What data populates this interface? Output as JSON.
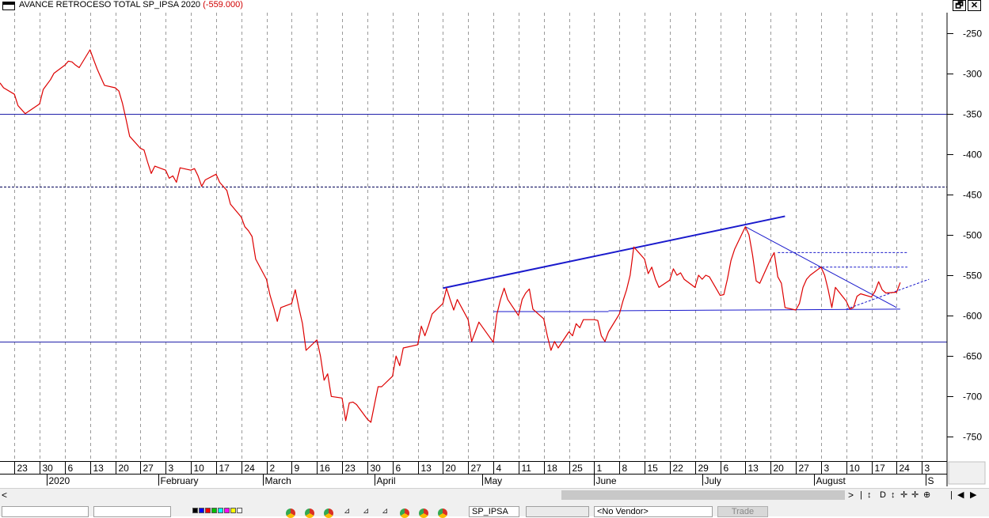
{
  "window": {
    "title": "AVANCE RETROCESO TOTAL SP_IPSA 2020",
    "last_value": "(-559.000)",
    "restore_label": "🗗",
    "close_label": "✕"
  },
  "colors": {
    "series": "#dd0000",
    "trendline": "#1a1acc",
    "level": "#2020aa",
    "grid": "#9a9a9a"
  },
  "chart_data": {
    "type": "line",
    "title": "AVANCE RETROCESO TOTAL SP_IPSA 2020",
    "ylim": [
      -780,
      -225
    ],
    "yticks": [
      -250,
      -300,
      -350,
      -400,
      -450,
      -500,
      -550,
      -600,
      -650,
      -700,
      -750
    ],
    "x_start": "2019-12-19",
    "x_end": "2020-09-07",
    "x_tick_labels": [
      {
        "date": "2019-12-23",
        "label": "23"
      },
      {
        "date": "2019-12-30",
        "label": "30"
      },
      {
        "date": "2020-01-06",
        "label": "6"
      },
      {
        "date": "2020-01-13",
        "label": "13"
      },
      {
        "date": "2020-01-20",
        "label": "20"
      },
      {
        "date": "2020-01-27",
        "label": "27"
      },
      {
        "date": "2020-02-03",
        "label": "3"
      },
      {
        "date": "2020-02-10",
        "label": "10"
      },
      {
        "date": "2020-02-17",
        "label": "17"
      },
      {
        "date": "2020-02-24",
        "label": "24"
      },
      {
        "date": "2020-03-02",
        "label": "2"
      },
      {
        "date": "2020-03-09",
        "label": "9"
      },
      {
        "date": "2020-03-16",
        "label": "16"
      },
      {
        "date": "2020-03-23",
        "label": "23"
      },
      {
        "date": "2020-03-30",
        "label": "30"
      },
      {
        "date": "2020-04-06",
        "label": "6"
      },
      {
        "date": "2020-04-13",
        "label": "13"
      },
      {
        "date": "2020-04-20",
        "label": "20"
      },
      {
        "date": "2020-04-27",
        "label": "27"
      },
      {
        "date": "2020-05-04",
        "label": "4"
      },
      {
        "date": "2020-05-11",
        "label": "11"
      },
      {
        "date": "2020-05-18",
        "label": "18"
      },
      {
        "date": "2020-05-25",
        "label": "25"
      },
      {
        "date": "2020-06-01",
        "label": "1"
      },
      {
        "date": "2020-06-08",
        "label": "8"
      },
      {
        "date": "2020-06-15",
        "label": "15"
      },
      {
        "date": "2020-06-22",
        "label": "22"
      },
      {
        "date": "2020-06-29",
        "label": "29"
      },
      {
        "date": "2020-07-06",
        "label": "6"
      },
      {
        "date": "2020-07-13",
        "label": "13"
      },
      {
        "date": "2020-07-20",
        "label": "20"
      },
      {
        "date": "2020-07-27",
        "label": "27"
      },
      {
        "date": "2020-08-03",
        "label": "3"
      },
      {
        "date": "2020-08-10",
        "label": "10"
      },
      {
        "date": "2020-08-17",
        "label": "17"
      },
      {
        "date": "2020-08-24",
        "label": "24"
      },
      {
        "date": "2020-08-31",
        "label": "3"
      }
    ],
    "month_labels": [
      {
        "date": "2020-01-01",
        "label": "2020"
      },
      {
        "date": "2020-02-01",
        "label": "February"
      },
      {
        "date": "2020-03-01",
        "label": "March"
      },
      {
        "date": "2020-04-01",
        "label": "April"
      },
      {
        "date": "2020-05-01",
        "label": "May"
      },
      {
        "date": "2020-06-01",
        "label": "June"
      },
      {
        "date": "2020-07-01",
        "label": "July"
      },
      {
        "date": "2020-08-01",
        "label": "August"
      },
      {
        "date": "2020-09-01",
        "label": "S"
      }
    ],
    "series": [
      {
        "points": [
          [
            "2019-12-19",
            -312
          ],
          [
            "2019-12-20",
            -318
          ],
          [
            "2019-12-23",
            -326
          ],
          [
            "2019-12-24",
            -340
          ],
          [
            "2019-12-26",
            -350
          ],
          [
            "2019-12-27",
            -347
          ],
          [
            "2019-12-30",
            -338
          ],
          [
            "2019-12-31",
            -320
          ],
          [
            "2020-01-02",
            -308
          ],
          [
            "2020-01-03",
            -300
          ],
          [
            "2020-01-06",
            -290
          ],
          [
            "2020-01-07",
            -285
          ],
          [
            "2020-01-08",
            -286
          ],
          [
            "2020-01-09",
            -290
          ],
          [
            "2020-01-10",
            -293
          ],
          [
            "2020-01-13",
            -271
          ],
          [
            "2020-01-14",
            -283
          ],
          [
            "2020-01-15",
            -295
          ],
          [
            "2020-01-16",
            -305
          ],
          [
            "2020-01-17",
            -315
          ],
          [
            "2020-01-20",
            -318
          ],
          [
            "2020-01-21",
            -322
          ],
          [
            "2020-01-22",
            -337
          ],
          [
            "2020-01-23",
            -357
          ],
          [
            "2020-01-24",
            -378
          ],
          [
            "2020-01-27",
            -393
          ],
          [
            "2020-01-28",
            -395
          ],
          [
            "2020-01-29",
            -410
          ],
          [
            "2020-01-30",
            -424
          ],
          [
            "2020-01-31",
            -415
          ],
          [
            "2020-02-03",
            -420
          ],
          [
            "2020-02-04",
            -430
          ],
          [
            "2020-02-05",
            -427
          ],
          [
            "2020-02-06",
            -435
          ],
          [
            "2020-02-07",
            -417
          ],
          [
            "2020-02-10",
            -420
          ],
          [
            "2020-02-11",
            -418
          ],
          [
            "2020-02-12",
            -427
          ],
          [
            "2020-02-13",
            -440
          ],
          [
            "2020-02-14",
            -432
          ],
          [
            "2020-02-17",
            -425
          ],
          [
            "2020-02-18",
            -435
          ],
          [
            "2020-02-19",
            -440
          ],
          [
            "2020-02-20",
            -445
          ],
          [
            "2020-02-21",
            -462
          ],
          [
            "2020-02-24",
            -478
          ],
          [
            "2020-02-25",
            -490
          ],
          [
            "2020-02-26",
            -495
          ],
          [
            "2020-02-27",
            -502
          ],
          [
            "2020-02-28",
            -530
          ],
          [
            "2020-03-02",
            -555
          ],
          [
            "2020-03-03",
            -575
          ],
          [
            "2020-03-04",
            -590
          ],
          [
            "2020-03-05",
            -607
          ],
          [
            "2020-03-06",
            -590
          ],
          [
            "2020-03-09",
            -585
          ],
          [
            "2020-03-10",
            -568
          ],
          [
            "2020-03-11",
            -590
          ],
          [
            "2020-03-12",
            -610
          ],
          [
            "2020-03-13",
            -643
          ],
          [
            "2020-03-16",
            -630
          ],
          [
            "2020-03-17",
            -650
          ],
          [
            "2020-03-18",
            -680
          ],
          [
            "2020-03-19",
            -672
          ],
          [
            "2020-03-20",
            -700
          ],
          [
            "2020-03-23",
            -702
          ],
          [
            "2020-03-24",
            -730
          ],
          [
            "2020-03-25",
            -708
          ],
          [
            "2020-03-26",
            -707
          ],
          [
            "2020-03-27",
            -710
          ],
          [
            "2020-03-30",
            -728
          ],
          [
            "2020-03-31",
            -732
          ],
          [
            "2020-04-01",
            -710
          ],
          [
            "2020-04-02",
            -688
          ],
          [
            "2020-04-03",
            -688
          ],
          [
            "2020-04-06",
            -675
          ],
          [
            "2020-04-07",
            -650
          ],
          [
            "2020-04-08",
            -662
          ],
          [
            "2020-04-09",
            -640
          ],
          [
            "2020-04-13",
            -636
          ],
          [
            "2020-04-14",
            -613
          ],
          [
            "2020-04-15",
            -625
          ],
          [
            "2020-04-16",
            -612
          ],
          [
            "2020-04-17",
            -598
          ],
          [
            "2020-04-20",
            -585
          ],
          [
            "2020-04-21",
            -566
          ],
          [
            "2020-04-22",
            -580
          ],
          [
            "2020-04-23",
            -593
          ],
          [
            "2020-04-24",
            -580
          ],
          [
            "2020-04-27",
            -605
          ],
          [
            "2020-04-28",
            -632
          ],
          [
            "2020-04-29",
            -620
          ],
          [
            "2020-04-30",
            -608
          ],
          [
            "2020-05-04",
            -633
          ],
          [
            "2020-05-05",
            -598
          ],
          [
            "2020-05-06",
            -580
          ],
          [
            "2020-05-07",
            -566
          ],
          [
            "2020-05-08",
            -580
          ],
          [
            "2020-05-11",
            -600
          ],
          [
            "2020-05-12",
            -580
          ],
          [
            "2020-05-13",
            -572
          ],
          [
            "2020-05-14",
            -567
          ],
          [
            "2020-05-15",
            -592
          ],
          [
            "2020-05-18",
            -604
          ],
          [
            "2020-05-19",
            -625
          ],
          [
            "2020-05-20",
            -643
          ],
          [
            "2020-05-21",
            -632
          ],
          [
            "2020-05-22",
            -640
          ],
          [
            "2020-05-25",
            -620
          ],
          [
            "2020-05-26",
            -625
          ],
          [
            "2020-05-27",
            -610
          ],
          [
            "2020-05-28",
            -615
          ],
          [
            "2020-05-29",
            -605
          ],
          [
            "2020-06-01",
            -605
          ],
          [
            "2020-06-02",
            -606
          ],
          [
            "2020-06-03",
            -625
          ],
          [
            "2020-06-04",
            -632
          ],
          [
            "2020-06-05",
            -620
          ],
          [
            "2020-06-08",
            -598
          ],
          [
            "2020-06-09",
            -582
          ],
          [
            "2020-06-10",
            -568
          ],
          [
            "2020-06-11",
            -550
          ],
          [
            "2020-06-12",
            -515
          ],
          [
            "2020-06-15",
            -530
          ],
          [
            "2020-06-16",
            -548
          ],
          [
            "2020-06-17",
            -540
          ],
          [
            "2020-06-18",
            -555
          ],
          [
            "2020-06-19",
            -565
          ],
          [
            "2020-06-22",
            -556
          ],
          [
            "2020-06-23",
            -542
          ],
          [
            "2020-06-24",
            -550
          ],
          [
            "2020-06-25",
            -547
          ],
          [
            "2020-06-26",
            -555
          ],
          [
            "2020-06-29",
            -565
          ],
          [
            "2020-06-30",
            -550
          ],
          [
            "2020-07-01",
            -555
          ],
          [
            "2020-07-02",
            -550
          ],
          [
            "2020-07-03",
            -552
          ],
          [
            "2020-07-06",
            -575
          ],
          [
            "2020-07-07",
            -574
          ],
          [
            "2020-07-08",
            -555
          ],
          [
            "2020-07-09",
            -532
          ],
          [
            "2020-07-10",
            -518
          ],
          [
            "2020-07-13",
            -490
          ],
          [
            "2020-07-14",
            -500
          ],
          [
            "2020-07-15",
            -525
          ],
          [
            "2020-07-16",
            -557
          ],
          [
            "2020-07-17",
            -560
          ],
          [
            "2020-07-20",
            -530
          ],
          [
            "2020-07-21",
            -522
          ],
          [
            "2020-07-22",
            -552
          ],
          [
            "2020-07-23",
            -560
          ],
          [
            "2020-07-24",
            -590
          ],
          [
            "2020-07-27",
            -593
          ],
          [
            "2020-07-28",
            -585
          ],
          [
            "2020-07-29",
            -565
          ],
          [
            "2020-07-30",
            -555
          ],
          [
            "2020-07-31",
            -550
          ],
          [
            "2020-08-03",
            -540
          ],
          [
            "2020-08-04",
            -550
          ],
          [
            "2020-08-05",
            -568
          ],
          [
            "2020-08-06",
            -590
          ],
          [
            "2020-08-07",
            -565
          ],
          [
            "2020-08-10",
            -582
          ],
          [
            "2020-08-11",
            -592
          ],
          [
            "2020-08-12",
            -590
          ],
          [
            "2020-08-13",
            -576
          ],
          [
            "2020-08-14",
            -573
          ],
          [
            "2020-08-17",
            -577
          ],
          [
            "2020-08-18",
            -570
          ],
          [
            "2020-08-19",
            -558
          ],
          [
            "2020-08-20",
            -568
          ],
          [
            "2020-08-21",
            -572
          ],
          [
            "2020-08-24",
            -571
          ],
          [
            "2020-08-25",
            -559
          ]
        ]
      }
    ],
    "h_lines": [
      {
        "y": -350,
        "style": "solid"
      },
      {
        "y": -440,
        "style": "dashed"
      },
      {
        "y": -632,
        "style": "solid"
      }
    ],
    "trendlines": [
      {
        "from": [
          "2020-04-20",
          -566
        ],
        "to": [
          "2020-07-24",
          -477
        ],
        "style": "solid",
        "width": 2
      },
      {
        "from": [
          "2020-07-13",
          -490
        ],
        "to": [
          "2020-08-24",
          -590
        ],
        "style": "solid",
        "width": 1
      },
      {
        "from": [
          "2020-05-04",
          -595
        ],
        "to": [
          "2020-06-05",
          -595
        ],
        "style": "solid",
        "width": 1
      },
      {
        "from": [
          "2020-06-05",
          -594
        ],
        "to": [
          "2020-08-25",
          -592
        ],
        "style": "solid",
        "width": 1
      },
      {
        "from": [
          "2020-08-10",
          -592
        ],
        "to": [
          "2020-09-02",
          -555
        ],
        "style": "dashed",
        "width": 1
      },
      {
        "from": [
          "2020-07-22",
          -522
        ],
        "to": [
          "2020-08-27",
          -522
        ],
        "style": "dashed",
        "width": 1
      },
      {
        "from": [
          "2020-07-31",
          -540
        ],
        "to": [
          "2020-08-27",
          -540
        ],
        "style": "dashed",
        "width": 1
      }
    ]
  },
  "scrollbar": {
    "left_arrow": "<",
    "right_arrow": ">",
    "nav_buttons": [
      "|",
      "↕",
      "D",
      "↕",
      "✛",
      "✛",
      "⊕",
      "|",
      "◀",
      "▶"
    ]
  },
  "toolbar": {
    "symbol": "SP_IPSA",
    "vendor": "<No Vendor>",
    "trade_label": "Trade",
    "swatch_colors": [
      "#000000",
      "#0000ff",
      "#ff0000",
      "#00c000",
      "#00ffff",
      "#ff00ff",
      "#ffff00",
      "#ffffff"
    ]
  }
}
